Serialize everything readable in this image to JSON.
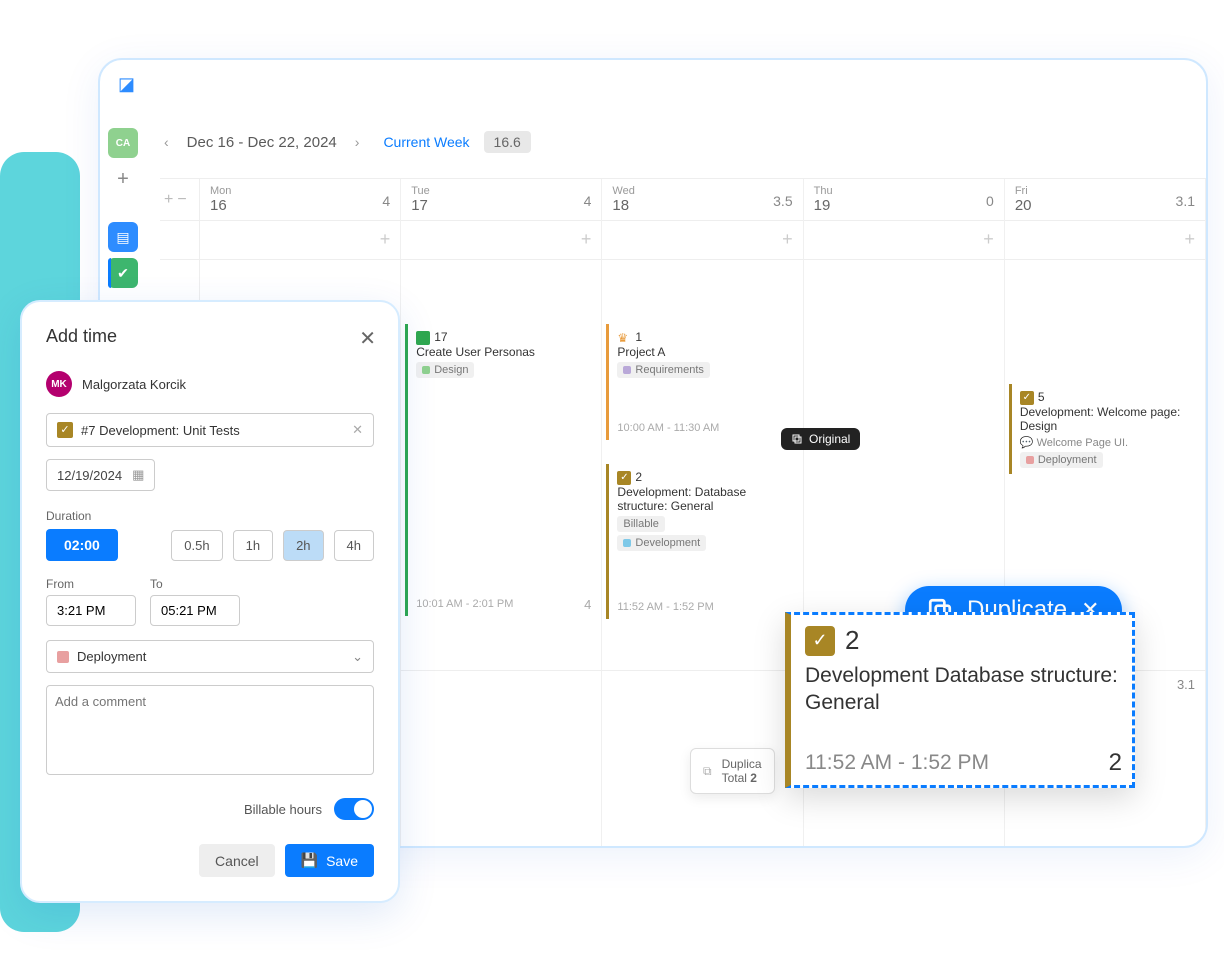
{
  "calendar": {
    "date_range": "Dec 16 - Dec 22, 2024",
    "current_week_label": "Current Week",
    "week_total": "16.6",
    "days": [
      {
        "name": "Mon",
        "num": "16",
        "total": "4"
      },
      {
        "name": "Tue",
        "num": "17",
        "total": "4"
      },
      {
        "name": "Wed",
        "num": "18",
        "total": "3.5"
      },
      {
        "name": "Thu",
        "num": "19",
        "total": "0"
      },
      {
        "name": "Fri",
        "num": "20",
        "total": "3.1"
      }
    ],
    "row2_fri_total": "3.1",
    "cards": {
      "tue": {
        "icon_num": "17",
        "title": "Create User Personas",
        "tag": "Design",
        "time": "10:01 AM - 2:01 PM",
        "count": "4"
      },
      "wed_a": {
        "icon_num": "1",
        "title": "Project A",
        "tag": "Requirements",
        "time": "10:00 AM - 11:30 AM"
      },
      "wed_b": {
        "icon_num": "2",
        "title": "Development: Database structure: General",
        "billable": "Billable",
        "tag": "Development",
        "time": "11:52 AM - 1:52 PM"
      },
      "fri": {
        "icon_num": "5",
        "title": "Development: Welcome page: Design",
        "sub": "Welcome Page UI.",
        "tag": "Deployment"
      }
    }
  },
  "original_pill": "Original",
  "duplicate": {
    "pill_label": "Duplicate",
    "num": "2",
    "title": "Development Database structure: General",
    "time": "11:52 AM - 1:52 PM",
    "count": "2",
    "hint_label": "Duplica",
    "hint_total_label": "Total",
    "hint_total": "2"
  },
  "modal": {
    "title": "Add time",
    "user": "Malgorzata Korcik",
    "avatar": "MK",
    "task": "#7 Development: Unit Tests",
    "date": "12/19/2024",
    "duration_label": "Duration",
    "duration_value": "02:00",
    "presets": [
      "0.5h",
      "1h",
      "2h",
      "4h"
    ],
    "from_label": "From",
    "to_label": "To",
    "from": "3:21 PM",
    "to": "05:21 PM",
    "category": "Deployment",
    "comment_placeholder": "Add a comment",
    "billable_label": "Billable hours",
    "cancel": "Cancel",
    "save": "Save"
  },
  "colors": {
    "accent": "#0a7cff",
    "gold": "#a88625",
    "green": "#2fa84f",
    "orange": "#e89b3c",
    "pink": "#e37ba8",
    "teal": "#5dd5dc"
  }
}
